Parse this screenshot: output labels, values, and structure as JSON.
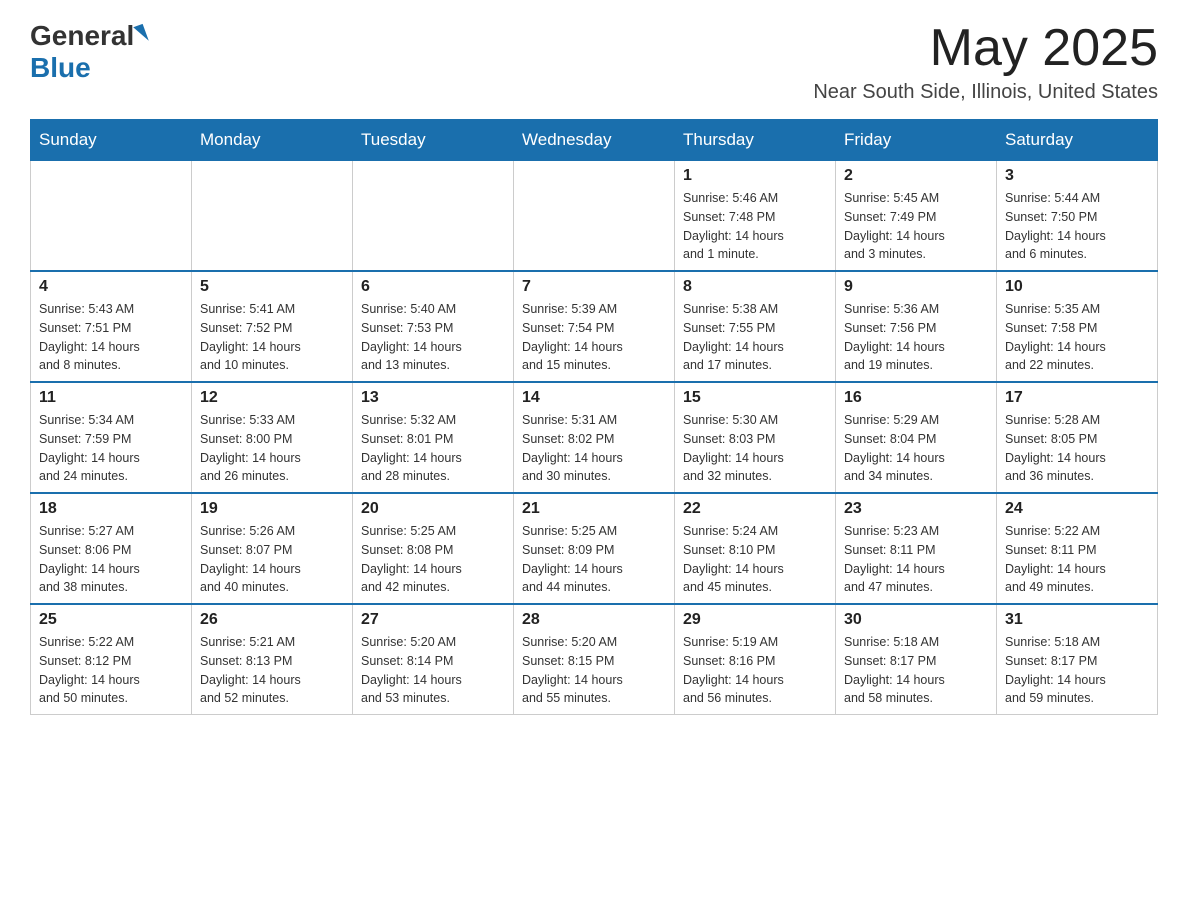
{
  "header": {
    "logo_general": "General",
    "logo_blue": "Blue",
    "month_year": "May 2025",
    "location": "Near South Side, Illinois, United States"
  },
  "days_of_week": [
    "Sunday",
    "Monday",
    "Tuesday",
    "Wednesday",
    "Thursday",
    "Friday",
    "Saturday"
  ],
  "weeks": [
    [
      {
        "day": "",
        "info": ""
      },
      {
        "day": "",
        "info": ""
      },
      {
        "day": "",
        "info": ""
      },
      {
        "day": "",
        "info": ""
      },
      {
        "day": "1",
        "info": "Sunrise: 5:46 AM\nSunset: 7:48 PM\nDaylight: 14 hours\nand 1 minute."
      },
      {
        "day": "2",
        "info": "Sunrise: 5:45 AM\nSunset: 7:49 PM\nDaylight: 14 hours\nand 3 minutes."
      },
      {
        "day": "3",
        "info": "Sunrise: 5:44 AM\nSunset: 7:50 PM\nDaylight: 14 hours\nand 6 minutes."
      }
    ],
    [
      {
        "day": "4",
        "info": "Sunrise: 5:43 AM\nSunset: 7:51 PM\nDaylight: 14 hours\nand 8 minutes."
      },
      {
        "day": "5",
        "info": "Sunrise: 5:41 AM\nSunset: 7:52 PM\nDaylight: 14 hours\nand 10 minutes."
      },
      {
        "day": "6",
        "info": "Sunrise: 5:40 AM\nSunset: 7:53 PM\nDaylight: 14 hours\nand 13 minutes."
      },
      {
        "day": "7",
        "info": "Sunrise: 5:39 AM\nSunset: 7:54 PM\nDaylight: 14 hours\nand 15 minutes."
      },
      {
        "day": "8",
        "info": "Sunrise: 5:38 AM\nSunset: 7:55 PM\nDaylight: 14 hours\nand 17 minutes."
      },
      {
        "day": "9",
        "info": "Sunrise: 5:36 AM\nSunset: 7:56 PM\nDaylight: 14 hours\nand 19 minutes."
      },
      {
        "day": "10",
        "info": "Sunrise: 5:35 AM\nSunset: 7:58 PM\nDaylight: 14 hours\nand 22 minutes."
      }
    ],
    [
      {
        "day": "11",
        "info": "Sunrise: 5:34 AM\nSunset: 7:59 PM\nDaylight: 14 hours\nand 24 minutes."
      },
      {
        "day": "12",
        "info": "Sunrise: 5:33 AM\nSunset: 8:00 PM\nDaylight: 14 hours\nand 26 minutes."
      },
      {
        "day": "13",
        "info": "Sunrise: 5:32 AM\nSunset: 8:01 PM\nDaylight: 14 hours\nand 28 minutes."
      },
      {
        "day": "14",
        "info": "Sunrise: 5:31 AM\nSunset: 8:02 PM\nDaylight: 14 hours\nand 30 minutes."
      },
      {
        "day": "15",
        "info": "Sunrise: 5:30 AM\nSunset: 8:03 PM\nDaylight: 14 hours\nand 32 minutes."
      },
      {
        "day": "16",
        "info": "Sunrise: 5:29 AM\nSunset: 8:04 PM\nDaylight: 14 hours\nand 34 minutes."
      },
      {
        "day": "17",
        "info": "Sunrise: 5:28 AM\nSunset: 8:05 PM\nDaylight: 14 hours\nand 36 minutes."
      }
    ],
    [
      {
        "day": "18",
        "info": "Sunrise: 5:27 AM\nSunset: 8:06 PM\nDaylight: 14 hours\nand 38 minutes."
      },
      {
        "day": "19",
        "info": "Sunrise: 5:26 AM\nSunset: 8:07 PM\nDaylight: 14 hours\nand 40 minutes."
      },
      {
        "day": "20",
        "info": "Sunrise: 5:25 AM\nSunset: 8:08 PM\nDaylight: 14 hours\nand 42 minutes."
      },
      {
        "day": "21",
        "info": "Sunrise: 5:25 AM\nSunset: 8:09 PM\nDaylight: 14 hours\nand 44 minutes."
      },
      {
        "day": "22",
        "info": "Sunrise: 5:24 AM\nSunset: 8:10 PM\nDaylight: 14 hours\nand 45 minutes."
      },
      {
        "day": "23",
        "info": "Sunrise: 5:23 AM\nSunset: 8:11 PM\nDaylight: 14 hours\nand 47 minutes."
      },
      {
        "day": "24",
        "info": "Sunrise: 5:22 AM\nSunset: 8:11 PM\nDaylight: 14 hours\nand 49 minutes."
      }
    ],
    [
      {
        "day": "25",
        "info": "Sunrise: 5:22 AM\nSunset: 8:12 PM\nDaylight: 14 hours\nand 50 minutes."
      },
      {
        "day": "26",
        "info": "Sunrise: 5:21 AM\nSunset: 8:13 PM\nDaylight: 14 hours\nand 52 minutes."
      },
      {
        "day": "27",
        "info": "Sunrise: 5:20 AM\nSunset: 8:14 PM\nDaylight: 14 hours\nand 53 minutes."
      },
      {
        "day": "28",
        "info": "Sunrise: 5:20 AM\nSunset: 8:15 PM\nDaylight: 14 hours\nand 55 minutes."
      },
      {
        "day": "29",
        "info": "Sunrise: 5:19 AM\nSunset: 8:16 PM\nDaylight: 14 hours\nand 56 minutes."
      },
      {
        "day": "30",
        "info": "Sunrise: 5:18 AM\nSunset: 8:17 PM\nDaylight: 14 hours\nand 58 minutes."
      },
      {
        "day": "31",
        "info": "Sunrise: 5:18 AM\nSunset: 8:17 PM\nDaylight: 14 hours\nand 59 minutes."
      }
    ]
  ]
}
